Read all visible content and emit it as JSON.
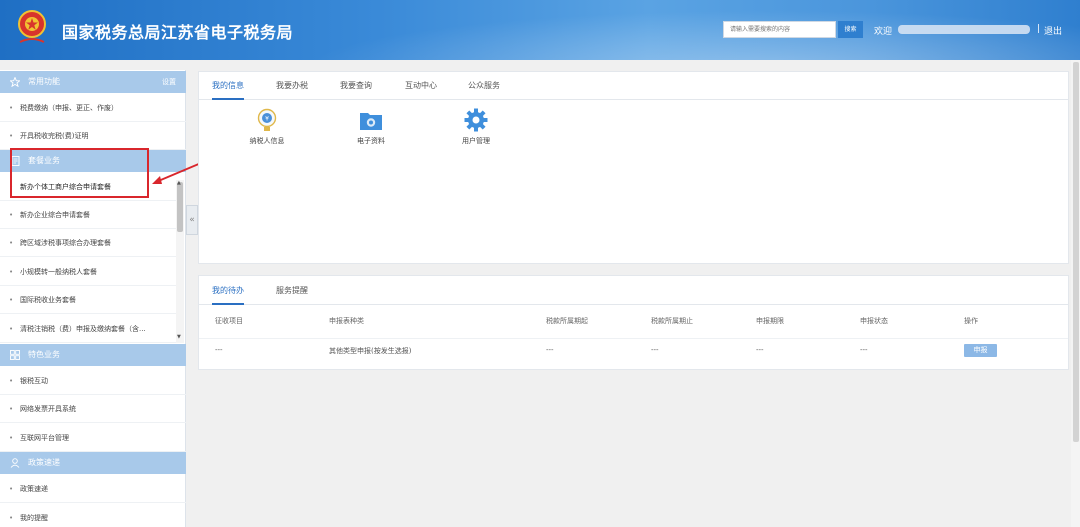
{
  "header": {
    "title": "国家税务总局江苏省电子税务局",
    "search_placeholder": "请输入需要搜索的内容",
    "search_button": "搜索",
    "welcome": "欢迎",
    "separator": "|",
    "logout": "退出"
  },
  "sidebar": {
    "common": {
      "title": "常用功能",
      "settings": "设置",
      "items": [
        "税费缴纳（申报、更正、作废）",
        "开具税收完税(费)证明"
      ]
    },
    "packages": {
      "title": "套餐业务",
      "items": [
        "新办个体工商户综合申请套餐",
        "新办企业综合申请套餐",
        "跨区域涉税事项综合办理套餐",
        "小规模转一般纳税人套餐",
        "国际税收业务套餐",
        "清税注销税（费）申报及缴纳套餐（含..."
      ]
    },
    "special": {
      "title": "特色业务",
      "items": [
        "银税互动",
        "网络发票开具系统",
        "互联网平台管理"
      ]
    },
    "policy": {
      "title": "政策速递",
      "items": [
        "政策速递",
        "我的提醒"
      ]
    }
  },
  "main": {
    "tabs": [
      "我的信息",
      "我要办税",
      "我要查询",
      "互动中心",
      "公众服务"
    ],
    "functions": [
      {
        "label": "纳税人信息",
        "icon": "taxpayer-info-icon"
      },
      {
        "label": "电子资料",
        "icon": "e-documents-icon"
      },
      {
        "label": "用户管理",
        "icon": "gear-icon"
      }
    ]
  },
  "todo": {
    "tabs": [
      "我的待办",
      "服务提醒"
    ],
    "columns": [
      "征收项目",
      "申报表种类",
      "税款所属期起",
      "税款所属期止",
      "申报期限",
      "申报状态",
      "操作"
    ],
    "rows": [
      {
        "item": "---",
        "form": "其他类型申报(按发生选报)",
        "start": "---",
        "end": "---",
        "deadline": "---",
        "status": "---",
        "action": "申报"
      }
    ]
  },
  "colors": {
    "header_blue": "#2f7fcf",
    "section_head": "#a8c9ea",
    "active_tab": "#2a6fc2",
    "annotation_red": "#d9262c"
  }
}
